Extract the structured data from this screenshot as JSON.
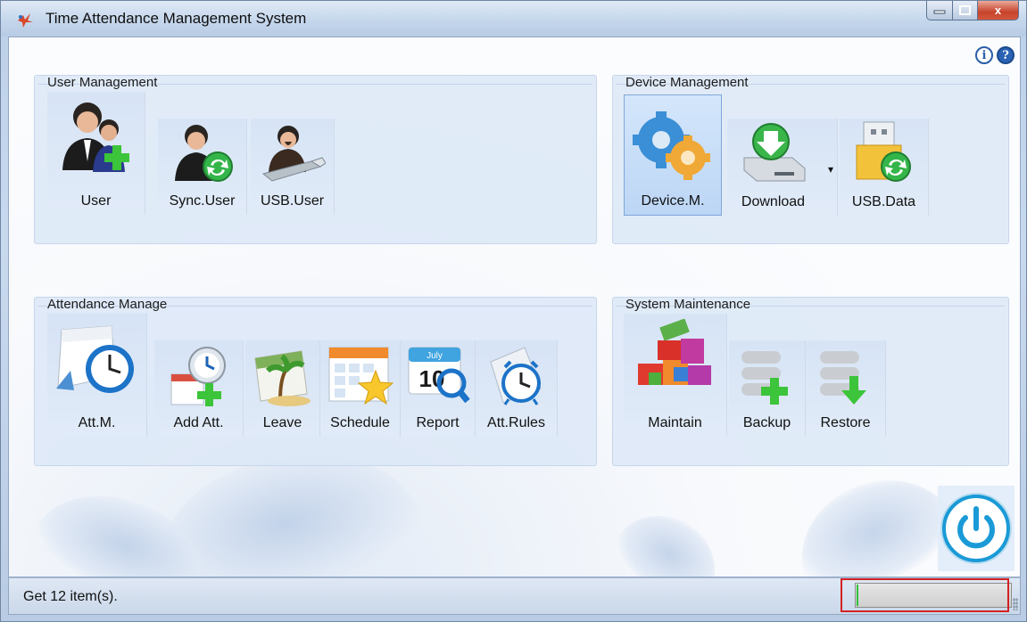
{
  "window": {
    "title": "Time Attendance Management System",
    "icon": "app-logo-icon",
    "caption_buttons": [
      "minimize",
      "maximize",
      "close"
    ],
    "close_glyph": "x"
  },
  "help": {
    "info": "i",
    "help": "?"
  },
  "groups": {
    "user": {
      "title": "User Management",
      "items": [
        {
          "label": "User",
          "icon": "users-add-icon"
        },
        {
          "label": "Sync.User",
          "icon": "user-sync-icon"
        },
        {
          "label": "USB.User",
          "icon": "usb-user-icon"
        }
      ]
    },
    "device": {
      "title": "Device Management",
      "items": [
        {
          "label": "Device.M.",
          "icon": "gears-icon",
          "selected": true
        },
        {
          "label": "Download",
          "icon": "download-drive-icon",
          "dropdown": "▾"
        },
        {
          "label": "USB.Data",
          "icon": "usb-data-icon"
        }
      ]
    },
    "attendance": {
      "title": "Attendance Manage",
      "items": [
        {
          "label": "Att.M.",
          "icon": "calendar-clock-icon"
        },
        {
          "label": "Add Att.",
          "icon": "add-attendance-icon"
        },
        {
          "label": "Leave",
          "icon": "leave-icon"
        },
        {
          "label": "Schedule",
          "icon": "schedule-icon"
        },
        {
          "label": "Report",
          "icon": "report-calendar-icon",
          "month": "July",
          "day": "10"
        },
        {
          "label": "Att.Rules",
          "icon": "alarm-clock-icon"
        }
      ]
    },
    "system": {
      "title": "System Maintenance",
      "items": [
        {
          "label": "Maintain",
          "icon": "blocks-icon"
        },
        {
          "label": "Backup",
          "icon": "database-add-icon"
        },
        {
          "label": "Restore",
          "icon": "database-restore-icon"
        }
      ]
    }
  },
  "power": {
    "icon": "power-icon"
  },
  "status": {
    "text": "Get 12 item(s).",
    "progress": 0.01
  },
  "colors": {
    "accent": "#1a9ad6",
    "highlight": "#d32222",
    "progress": "#2fc03b"
  }
}
